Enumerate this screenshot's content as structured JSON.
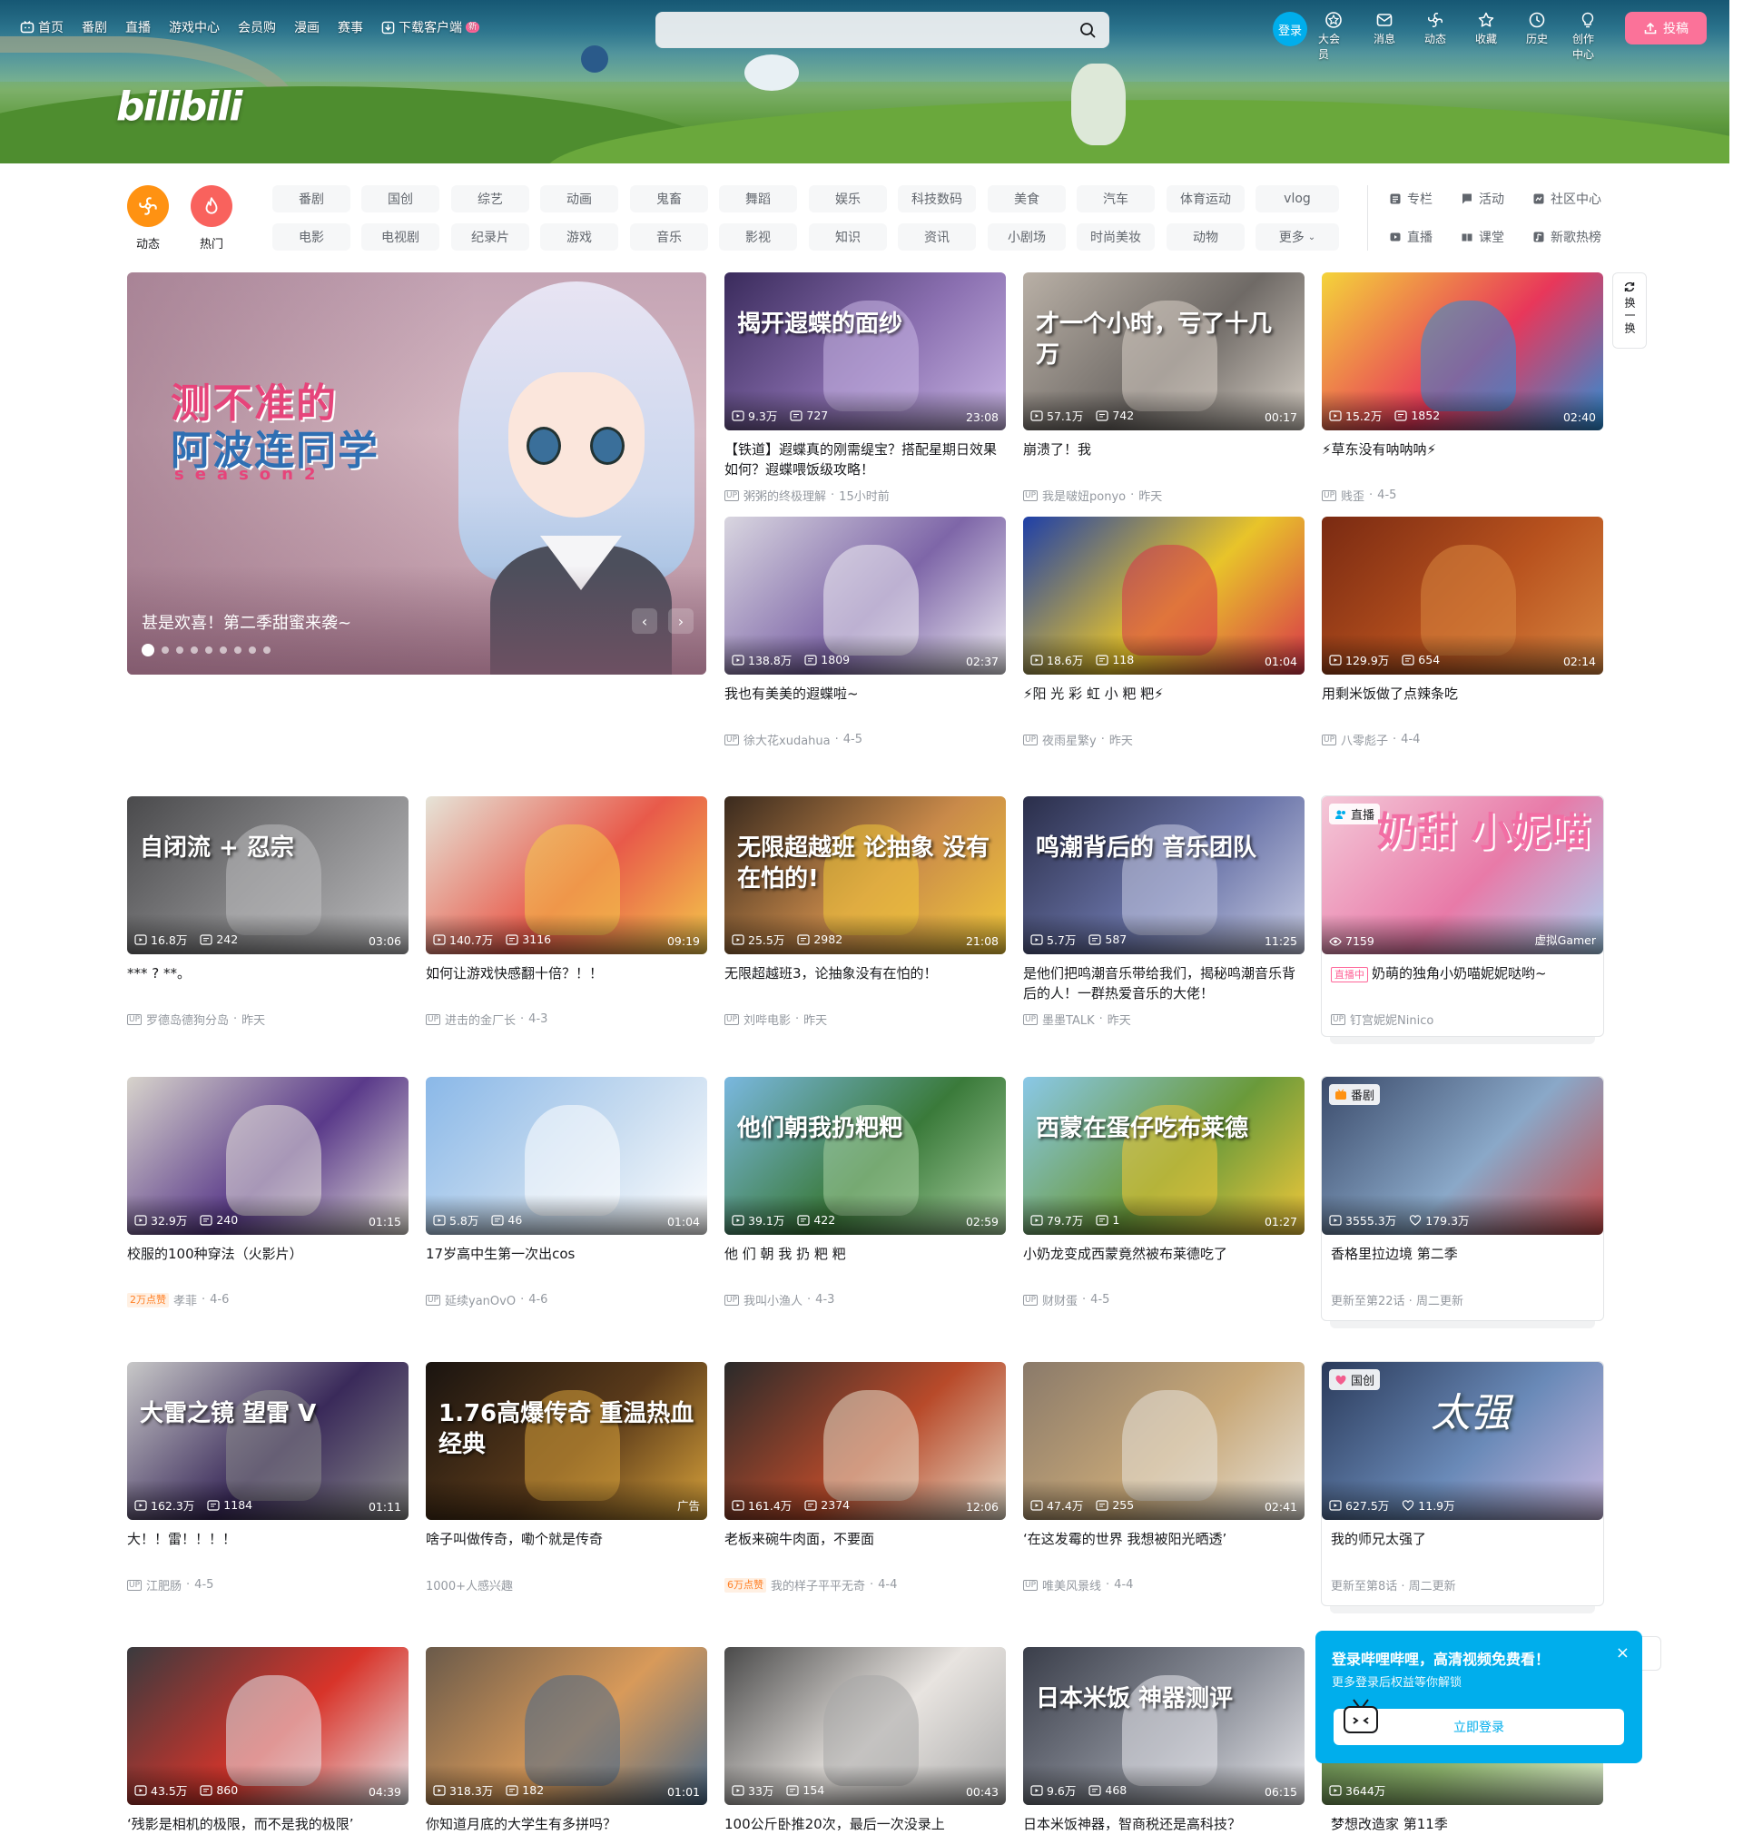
{
  "header": {
    "nav_left": [
      {
        "label": "首页",
        "icon": "tv-icon"
      },
      {
        "label": "番剧"
      },
      {
        "label": "直播"
      },
      {
        "label": "游戏中心"
      },
      {
        "label": "会员购"
      },
      {
        "label": "漫画"
      },
      {
        "label": "赛事"
      },
      {
        "label": "下载客户端",
        "icon": "download-icon",
        "badge": "新"
      }
    ],
    "search_placeholder": "",
    "login_label": "登录",
    "nav_right": [
      {
        "label": "大会员",
        "icon": "vip-icon"
      },
      {
        "label": "消息",
        "icon": "message-icon"
      },
      {
        "label": "动态",
        "icon": "dynamic-icon"
      },
      {
        "label": "收藏",
        "icon": "star-icon"
      },
      {
        "label": "历史",
        "icon": "clock-icon"
      },
      {
        "label": "创作中心",
        "icon": "bulb-icon"
      }
    ],
    "upload_label": "投稿",
    "logo_text": "bilibili"
  },
  "channels": {
    "circles": [
      {
        "label": "动态",
        "color": "#ff9212"
      },
      {
        "label": "热门",
        "color": "#f9625d"
      }
    ],
    "row1": [
      "番剧",
      "国创",
      "综艺",
      "动画",
      "鬼畜",
      "舞蹈",
      "娱乐",
      "科技数码",
      "美食",
      "汽车",
      "体育运动",
      "vlog"
    ],
    "row2": [
      "电影",
      "电视剧",
      "纪录片",
      "游戏",
      "音乐",
      "影视",
      "知识",
      "资讯",
      "小剧场",
      "时尚美妆",
      "动物",
      "更多"
    ],
    "right_links": [
      {
        "label": "专栏",
        "icon": "column-icon"
      },
      {
        "label": "活动",
        "icon": "flag-icon"
      },
      {
        "label": "社区中心",
        "icon": "community-icon"
      },
      {
        "label": "直播",
        "icon": "live-icon"
      },
      {
        "label": "课堂",
        "icon": "classroom-icon"
      },
      {
        "label": "新歌热榜",
        "icon": "music-chart-icon"
      }
    ]
  },
  "carousel": {
    "title_line1": "测不准的",
    "title_line2": "阿波连同学",
    "title_line3": "season2",
    "caption": "甚是欢喜！第二季甜蜜来袭~",
    "dot_count": 9,
    "active_dot": 0
  },
  "refresh_label": "换一换",
  "cards": [
    {
      "id": "c1",
      "views": "9.3万",
      "danmaku": "727",
      "duration": "23:08",
      "title": "【铁道】遐蝶真的刚需缇宝？搭配星期日效果如何？遐蝶喂饭级攻略！",
      "author": "粥粥的终极理解",
      "date": "15小时前",
      "overlay": "揭开遐蝶的面纱",
      "colors": [
        "#3a2b5c",
        "#8a6fb0",
        "#c9b6e4"
      ]
    },
    {
      "id": "c2",
      "views": "57.1万",
      "danmaku": "742",
      "duration": "00:17",
      "title": "崩溃了！我",
      "author": "我是啵妞ponyo",
      "date": "昨天",
      "overlay": "才一个小时，亏了十几万",
      "colors": [
        "#b9b0a6",
        "#6f6a66",
        "#d8d0c6"
      ]
    },
    {
      "id": "c3",
      "views": "15.2万",
      "danmaku": "1852",
      "duration": "02:40",
      "title": "⚡草东没有呐呐呐⚡",
      "author": "贱歪",
      "date": "4-5",
      "overlay": "",
      "colors": [
        "#f4d43a",
        "#e8375a",
        "#2a8fd8"
      ]
    },
    {
      "id": "c4",
      "views": "138.8万",
      "danmaku": "1809",
      "duration": "02:37",
      "title": "我也有美美的遐蝶啦~",
      "author": "徐大花xudahua",
      "date": "4-5",
      "overlay": "",
      "colors": [
        "#d9d6e0",
        "#7e66a8",
        "#f0eef4"
      ]
    },
    {
      "id": "c5",
      "views": "18.6万",
      "danmaku": "118",
      "duration": "01:04",
      "title": "⚡阳 光 彩 虹 小 粑 粑⚡",
      "author": "夜雨星繁y",
      "date": "昨天",
      "overlay": "",
      "colors": [
        "#1e3fa8",
        "#e8c42a",
        "#d8344a"
      ]
    },
    {
      "id": "c6",
      "views": "129.9万",
      "danmaku": "654",
      "duration": "02:14",
      "title": "用剩米饭做了点辣条吃",
      "author": "八零彪子",
      "date": "4-4",
      "overlay": "",
      "colors": [
        "#7a2a12",
        "#b8521e",
        "#d98640"
      ]
    },
    {
      "id": "c7",
      "views": "16.8万",
      "danmaku": "242",
      "duration": "03:06",
      "title": "*** ? **。",
      "author": "罗德岛德狗分岛",
      "date": "昨天",
      "overlay": "自闭流 + 忍宗",
      "colors": [
        "#4a4a4c",
        "#8a8a8c",
        "#bdbdbf"
      ]
    },
    {
      "id": "c8",
      "views": "140.7万",
      "danmaku": "3116",
      "duration": "09:19",
      "title": "如何让游戏快感翻十倍？！！",
      "author": "进击的金厂长",
      "date": "4-3",
      "overlay": "",
      "colors": [
        "#e6e4d8",
        "#e85a4a",
        "#f4c84a"
      ]
    },
    {
      "id": "c9",
      "views": "25.5万",
      "danmaku": "2982",
      "duration": "21:08",
      "title": "无限超越班3，论抽象没有在怕的！",
      "author": "刘哔电影",
      "date": "昨天",
      "overlay": "无限超越班 论抽象 没有在怕的!",
      "colors": [
        "#3a2a1e",
        "#c98a4a",
        "#f2c83a"
      ]
    },
    {
      "id": "c10",
      "views": "5.7万",
      "danmaku": "587",
      "duration": "11:25",
      "title": "是他们把鸣潮音乐带给我们，揭秘鸣潮音乐背后的人！一群热爱音乐的大佬！",
      "author": "墨墨TALK",
      "date": "昨天",
      "overlay": "鸣潮背后的 音乐团队",
      "colors": [
        "#2a2e4a",
        "#6a74a8",
        "#c8cce4"
      ]
    },
    {
      "id": "c12",
      "views": "32.9万",
      "danmaku": "240",
      "duration": "01:15",
      "title": "校服的100种穿法（火影片）",
      "author": "孝菲",
      "date": "4-6",
      "badge": "2万点赞",
      "overlay": "",
      "colors": [
        "#d8d4cc",
        "#5a3a8a",
        "#e8e4dc"
      ]
    },
    {
      "id": "c13",
      "views": "5.8万",
      "danmaku": "46",
      "duration": "01:04",
      "title": "17岁高中生第一次出cos",
      "author": "延续yanOvO",
      "date": "4-6",
      "overlay": "",
      "colors": [
        "#8ab8e8",
        "#c8dcf0",
        "#ffffff"
      ]
    },
    {
      "id": "c14",
      "views": "39.1万",
      "danmaku": "422",
      "duration": "02:59",
      "title": "他 们 朝 我 扔 粑 粑",
      "author": "我叫小渔人",
      "date": "4-3",
      "overlay": "他们朝我扔粑粑",
      "colors": [
        "#7ab8e0",
        "#3a7a3a",
        "#a8d0a0"
      ]
    },
    {
      "id": "c15",
      "views": "79.7万",
      "danmaku": "1",
      "duration": "01:27",
      "title": "小奶龙变成西蒙竟然被布莱德吃了",
      "author": "财财蛋",
      "date": "4-5",
      "overlay": "西蒙在蛋仔吃布莱德",
      "colors": [
        "#8ac8e8",
        "#6a9a3a",
        "#f2c83a"
      ]
    },
    {
      "id": "c17",
      "views": "162.3万",
      "danmaku": "1184",
      "duration": "01:11",
      "title": "大！！雷！！！！",
      "author": "江肥肠",
      "date": "4-5",
      "overlay": "大雷之镜 望雷 V",
      "colors": [
        "#c8c8c8",
        "#3a2a5a",
        "#8a8a8a"
      ]
    },
    {
      "id": "c18",
      "views": "",
      "danmaku": "",
      "duration": "广告",
      "title": "啥子叫做传奇，嘞个就是传奇",
      "author": "",
      "date": "",
      "info": "1000+人感兴趣",
      "overlay": "1.76高爆传奇 重温热血经典",
      "colors": [
        "#1a1410",
        "#5a3a1a",
        "#d8a23a"
      ]
    },
    {
      "id": "c19",
      "views": "161.4万",
      "danmaku": "2374",
      "duration": "12:06",
      "title": "老板来碗牛肉面，不要面",
      "author": "我的样子平平无奇",
      "date": "4-4",
      "badge": "6万点赞",
      "overlay": "",
      "colors": [
        "#2a2a2a",
        "#b84a2a",
        "#e8dcc8"
      ]
    },
    {
      "id": "c20",
      "views": "47.4万",
      "danmaku": "255",
      "duration": "02:41",
      "title": "‘在这发霉的世界 我想被阳光晒透’",
      "author": "唯美风景线",
      "date": "4-4",
      "overlay": "",
      "colors": [
        "#8a7a6a",
        "#c8a878",
        "#e8e4dc"
      ]
    },
    {
      "id": "c22",
      "views": "43.5万",
      "danmaku": "860",
      "duration": "04:39",
      "title": "‘残影是相机的极限，而不是我的极限’",
      "author": "",
      "date": "",
      "overlay": "",
      "colors": [
        "#3a3a3e",
        "#d8342a",
        "#e8e8ec"
      ]
    },
    {
      "id": "c23",
      "views": "318.3万",
      "danmaku": "182",
      "duration": "01:01",
      "title": "你知道月底的大学生有多拼吗？",
      "author": "",
      "date": "",
      "overlay": "",
      "colors": [
        "#6a5a4a",
        "#d89a5a",
        "#4a6a8a"
      ]
    },
    {
      "id": "c24",
      "views": "33万",
      "danmaku": "154",
      "duration": "00:43",
      "title": "100公斤卧推20次，最后一次没录上",
      "author": "",
      "date": "",
      "overlay": "",
      "colors": [
        "#4a4a4a",
        "#e8e4e0",
        "#a8a8a8"
      ]
    },
    {
      "id": "c25",
      "views": "9.6万",
      "danmaku": "468",
      "duration": "06:15",
      "title": "日本米饭神器，智商税还是高科技？",
      "author": "",
      "date": "",
      "overlay": "日本米饭 神器测评",
      "colors": [
        "#3a3e4a",
        "#8a8e98",
        "#e8e8ec"
      ]
    }
  ],
  "live_card": {
    "tag": "直播",
    "viewers": "7159",
    "category": "虚拟Gamer",
    "live_label": "直播中",
    "title": "奶萌的独角小奶喵妮妮哒哟~",
    "author": "钉宫妮妮Ninico",
    "overlay": "奶甜 小妮喵",
    "colors": [
      "#f4c8d8",
      "#e87aa8",
      "#a8d0f0"
    ]
  },
  "bangumi_card": {
    "tag": "番剧",
    "views": "3555.3万",
    "likes": "179.3万",
    "title": "香格里拉边境 第二季",
    "info": "更新至第22话 · 周二更新",
    "colors": [
      "#3a4a6a",
      "#8aa8c8",
      "#c84a4a"
    ]
  },
  "guochuang_card": {
    "tag": "国创",
    "views": "627.5万",
    "likes": "11.9万",
    "title": "我的师兄太强了",
    "info": "更新至第8话 · 周二更新",
    "overlay": "太强",
    "colors": [
      "#2a3a5a",
      "#6a8ab8",
      "#c8b8e0"
    ]
  },
  "last_card": {
    "views": "3644万",
    "title": "梦想改造家 第11季",
    "colors": [
      "#4a6a3a",
      "#8ab06a",
      "#d8e8c8"
    ]
  },
  "login_popup": {
    "title": "登录哔哩哔哩，高清视频免费看！",
    "subtitle": "更多登录后权益等你解锁",
    "button": "立即登录",
    "close": "×"
  },
  "theme": {
    "accent": "#00aeec",
    "pink": "#fb7299"
  }
}
